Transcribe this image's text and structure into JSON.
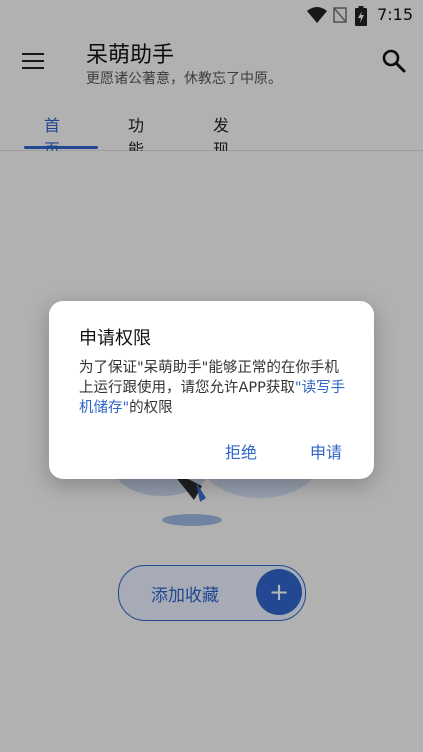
{
  "status_bar": {
    "time": "7:15"
  },
  "app_bar": {
    "title": "呆萌助手",
    "subtitle": "更愿诸公著意，休教忘了中原。"
  },
  "tabs": [
    {
      "label": "首页",
      "active": true
    },
    {
      "label": "功能",
      "active": false
    },
    {
      "label": "发现",
      "active": false
    }
  ],
  "main": {
    "add_favorite_label": "添加收藏",
    "add_favorite_icon": "+"
  },
  "dialog": {
    "title": "申请权限",
    "body_part1": "为了保证\"呆萌助手\"能够正常的在你手机上运行跟使用，请您允许APP获取",
    "body_link": "\"读写手机储存\"",
    "body_part2": "的权限",
    "deny_label": "拒绝",
    "allow_label": "申请"
  },
  "colors": {
    "accent": "#2f64c9",
    "scrim": "rgba(0,0,0,0.28)"
  }
}
